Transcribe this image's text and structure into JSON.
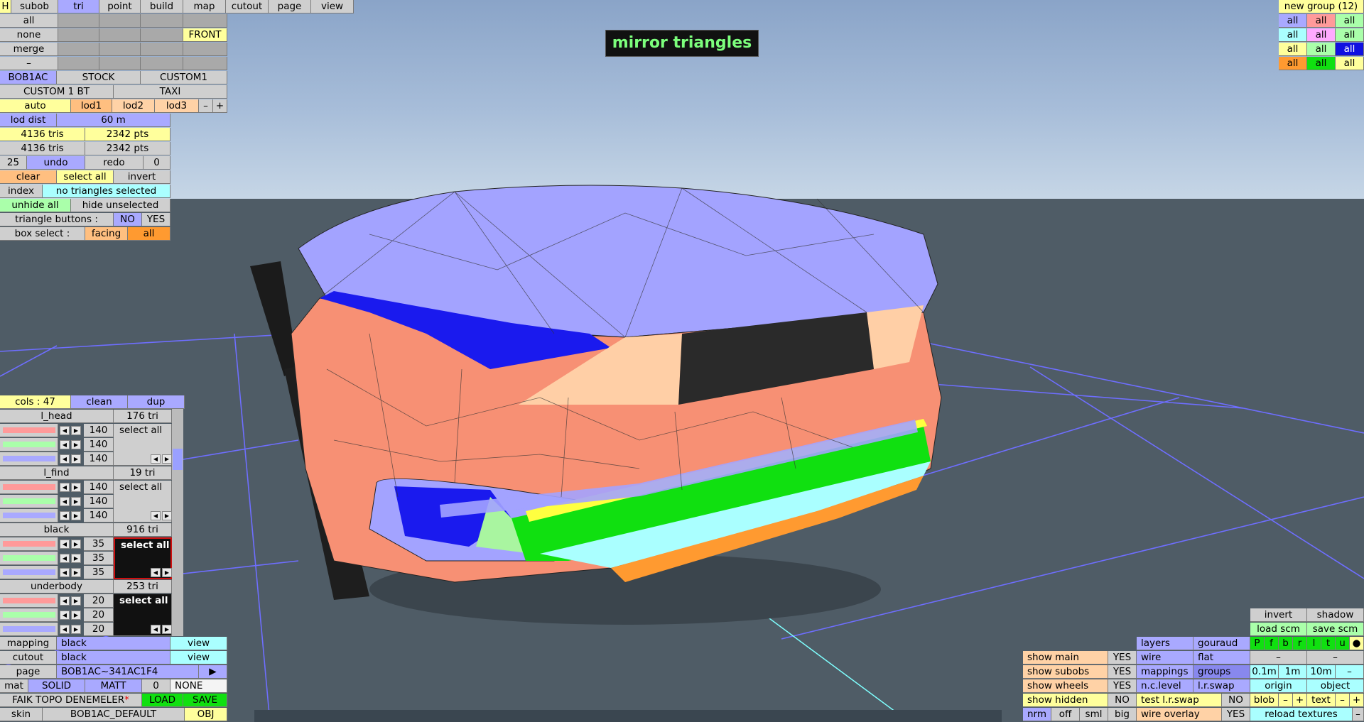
{
  "hud_title": "mirror triangles",
  "top_menu": [
    "H",
    "subob",
    "tri",
    "point",
    "build",
    "map",
    "cutout",
    "page",
    "view"
  ],
  "sel_col": [
    "all",
    "none",
    "merge",
    "–"
  ],
  "front": "FRONT",
  "variants": [
    "BOB1AC",
    "STOCK",
    "CUSTOM1"
  ],
  "variants2": [
    "CUSTOM 1 BT",
    "TAXI"
  ],
  "lod": {
    "auto": "auto",
    "lod1": "lod1",
    "lod2": "lod2",
    "lod3": "lod3",
    "minus": "–",
    "plus": "+"
  },
  "lod_dist": {
    "label": "lod dist",
    "value": "60 m"
  },
  "stats": [
    {
      "tris": "4136 tris",
      "pts": "2342 pts"
    },
    {
      "tris": "4136 tris",
      "pts": "2342 pts"
    }
  ],
  "undo": {
    "count": "25",
    "undo": "undo",
    "redo": "redo",
    "redo_count": "0"
  },
  "sel_ops": [
    "clear",
    "select all",
    "invert"
  ],
  "index": {
    "label": "index",
    "value": "no triangles selected"
  },
  "hide": [
    "unhide all",
    "hide unselected"
  ],
  "tri_buttons": {
    "label": "triangle buttons :",
    "no": "NO",
    "yes": "YES"
  },
  "box_select": {
    "label": "box select :",
    "facing": "facing",
    "all": "all"
  },
  "cols": {
    "label": "cols : 47",
    "clean": "clean",
    "dup": "dup"
  },
  "materials": [
    {
      "name": "l_head",
      "tris": "176 tri",
      "vals": [
        "140",
        "140",
        "140"
      ],
      "btn": "select all"
    },
    {
      "name": "l_find",
      "tris": "19 tri",
      "vals": [
        "140",
        "140",
        "140"
      ],
      "btn": "select all"
    },
    {
      "name": "black",
      "tris": "916 tri",
      "vals": [
        "35",
        "35",
        "35"
      ],
      "btn": "select all"
    },
    {
      "name": "underbody",
      "tris": "253 tri",
      "vals": [
        "20",
        "20",
        "20"
      ],
      "btn": "select all"
    }
  ],
  "mapping": {
    "label": "mapping",
    "value": "black",
    "view": "view"
  },
  "cutout": {
    "label": "cutout",
    "value": "black",
    "view": "view"
  },
  "page": {
    "label": "page",
    "value": "BOB1AC~341AC1F4",
    "arrow": "▶"
  },
  "mat": {
    "label": "mat",
    "solid": "SOLID",
    "matt": "MATT",
    "num": "0",
    "none": "NONE"
  },
  "file": {
    "name": "FAIK TOPO DENEMELER",
    "star": "*",
    "load": "LOAD",
    "save": "SAVE"
  },
  "skin": {
    "label": "skin",
    "value": "BOB1AC_DEFAULT",
    "obj": "OBJ"
  },
  "new_group": "new group (12)",
  "group_all": "all",
  "right_panel": {
    "invert": "invert",
    "shadow": "shadow",
    "load_scm": "load scm",
    "save_scm": "save scm",
    "layers": "layers",
    "gouraud": "gouraud",
    "wire": "wire",
    "flat": "flat",
    "mappings": "mappings",
    "groups": "groups",
    "nclevel": "n.c.level",
    "lrswap": "l.r.swap",
    "test_lrswap": "test l.r.swap",
    "test_no": "NO",
    "wire_overlay": "wire overlay",
    "wire_yes": "YES",
    "show_main": "show main",
    "show_subobs": "show subobs",
    "show_wheels": "show wheels",
    "show_hidden": "show hidden",
    "yes": "YES",
    "no": "NO",
    "pfbrltu": [
      "P",
      "f",
      "b",
      "r",
      "l",
      "t",
      "u",
      "●"
    ],
    "minus": "–",
    "plus": "+",
    "dist": [
      "0.1m",
      "1m",
      "10m"
    ],
    "origin": "origin",
    "object": "object",
    "blob": "blob",
    "text": "text",
    "nrm": "nrm",
    "off": "off",
    "sml": "sml",
    "big": "big",
    "reload": "reload textures"
  },
  "colors": {
    "accent": "#a9a9ff",
    "yellow": "#ffff9c",
    "orange": "#ffbf80",
    "cyan": "#aaffff",
    "green": "#aaffaa"
  }
}
